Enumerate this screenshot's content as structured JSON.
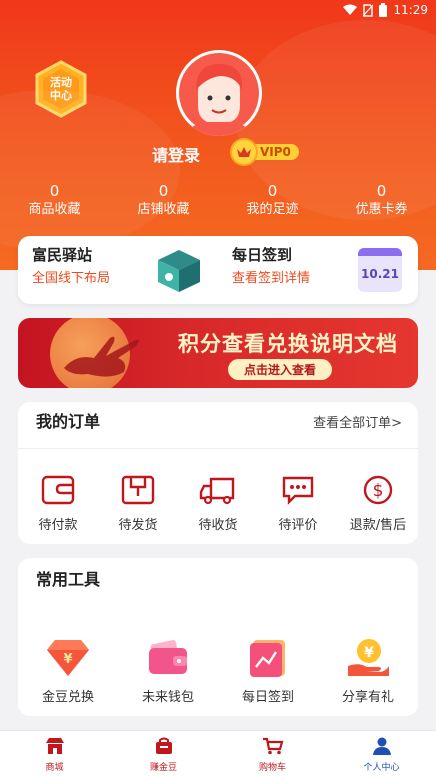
{
  "status_bar": {
    "time": "11:29"
  },
  "header": {
    "activity_badge": {
      "line1": "活动",
      "line2": "中心"
    },
    "login_text": "请登录",
    "vip_label": "VIP0",
    "stats": [
      {
        "count": "0",
        "label": "商品收藏"
      },
      {
        "count": "0",
        "label": "店铺收藏"
      },
      {
        "count": "0",
        "label": "我的足迹"
      },
      {
        "count": "0",
        "label": "优惠卡券"
      }
    ]
  },
  "quick_links": {
    "station": {
      "title": "富民驿站",
      "subtitle": "全国线下布局"
    },
    "signin": {
      "title": "每日签到",
      "subtitle": "查看签到详情",
      "calendar_date": "10.21"
    }
  },
  "banner": {
    "title": "积分查看兑换说明文档",
    "button": "点击进入查看"
  },
  "orders": {
    "title": "我的订单",
    "view_all": "查看全部订单>",
    "items": [
      {
        "label": "待付款",
        "icon": "wallet-icon"
      },
      {
        "label": "待发货",
        "icon": "package-icon"
      },
      {
        "label": "待收货",
        "icon": "truck-icon"
      },
      {
        "label": "待评价",
        "icon": "comment-icon"
      },
      {
        "label": "退款/售后",
        "icon": "refund-icon"
      }
    ]
  },
  "tools": {
    "title": "常用工具",
    "items": [
      {
        "label": "金豆兑换",
        "icon": "gold-bean-icon"
      },
      {
        "label": "未来钱包",
        "icon": "wallet-icon"
      },
      {
        "label": "每日签到",
        "icon": "chart-icon"
      },
      {
        "label": "分享有礼",
        "icon": "coin-hand-icon"
      }
    ]
  },
  "bottom_nav": [
    {
      "label": "商城",
      "icon": "shop-icon"
    },
    {
      "label": "赚金豆",
      "icon": "bag-icon"
    },
    {
      "label": "购物车",
      "icon": "cart-icon"
    },
    {
      "label": "个人中心",
      "icon": "user-icon"
    }
  ],
  "colors": {
    "primary": "#f0381a",
    "accent": "#c0171d",
    "nav_active": "#1f4fb5"
  }
}
